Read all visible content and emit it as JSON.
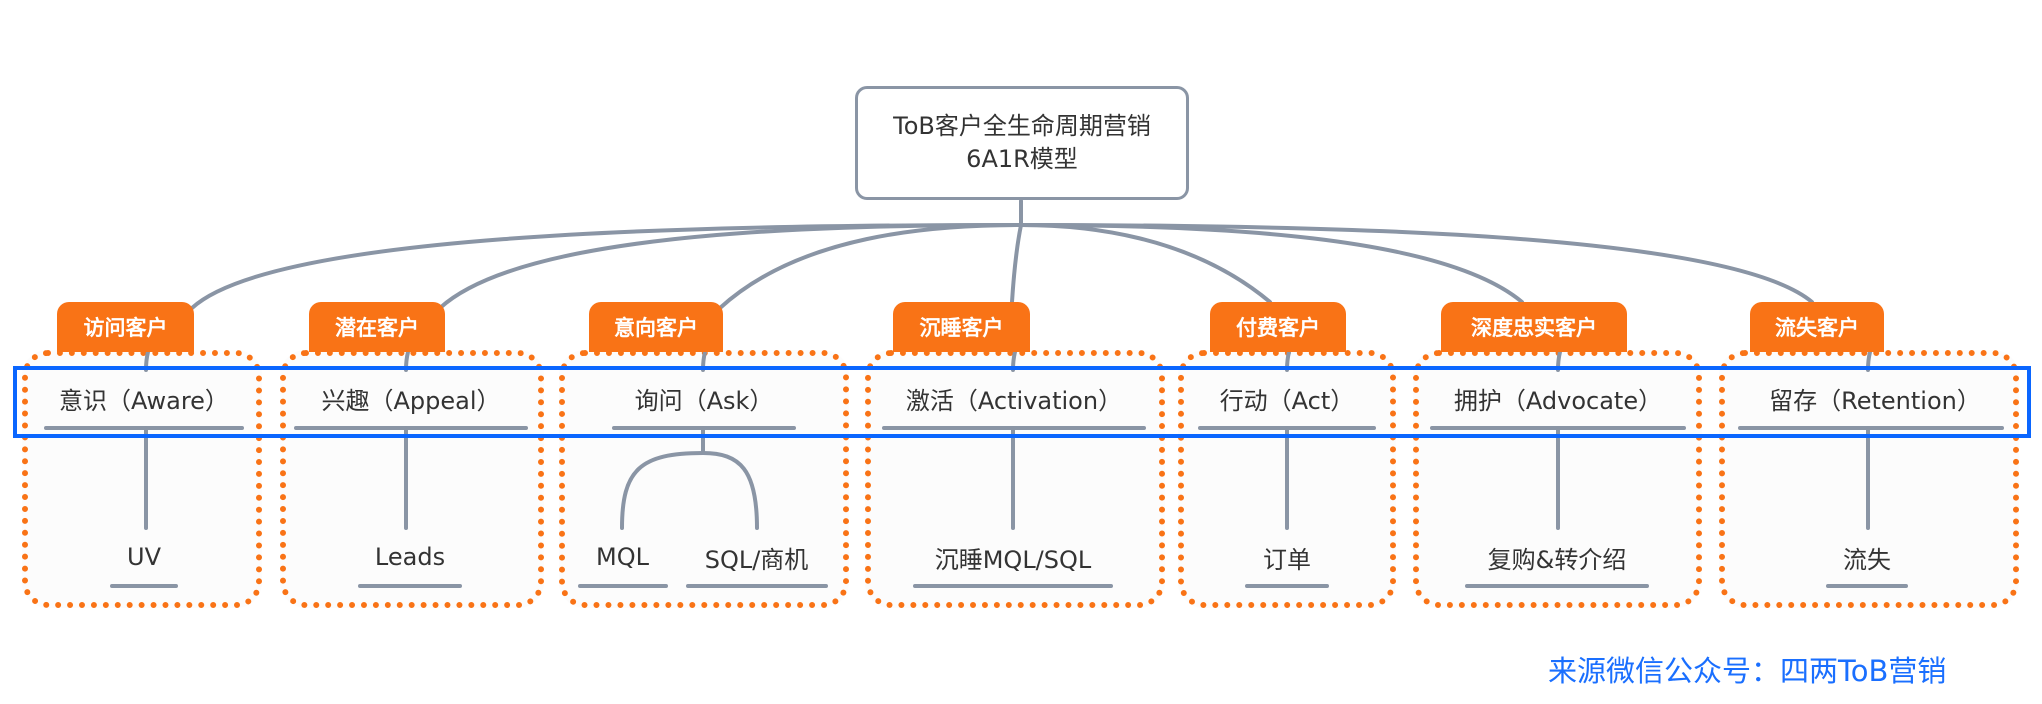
{
  "root": {
    "title_line1": "ToB客户全生命周期营销",
    "title_line2": "6A1R模型"
  },
  "stages": [
    {
      "tag": "访问客户",
      "phase": "意识（Aware）",
      "leaves": [
        "UV"
      ]
    },
    {
      "tag": "潜在客户",
      "phase": "兴趣（Appeal）",
      "leaves": [
        "Leads"
      ]
    },
    {
      "tag": "意向客户",
      "phase": "询问（Ask）",
      "leaves": [
        "MQL",
        "SQL/商机"
      ]
    },
    {
      "tag": "沉睡客户",
      "phase": "激活（Activation）",
      "leaves": [
        "沉睡MQL/SQL"
      ]
    },
    {
      "tag": "付费客户",
      "phase": "行动（Act）",
      "leaves": [
        "订单"
      ]
    },
    {
      "tag": "深度忠实客户",
      "phase": "拥护（Advocate）",
      "leaves": [
        "复购&转介绍"
      ]
    },
    {
      "tag": "流失客户",
      "phase": "留存（Retention）",
      "leaves": [
        "流失"
      ]
    }
  ],
  "source": "来源微信公众号：四两ToB营销",
  "colors": {
    "accent": "#f97316",
    "highlight": "#0a66ff",
    "connector": "#8a95a5",
    "source_text": "#1a6fff"
  }
}
